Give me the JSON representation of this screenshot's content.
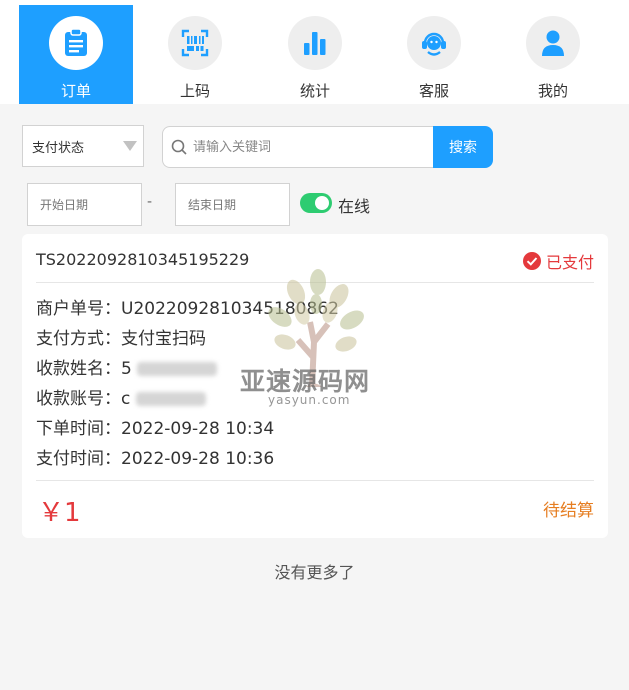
{
  "nav": {
    "items": [
      {
        "label": "订单",
        "icon": "order-icon",
        "active": true
      },
      {
        "label": "上码",
        "icon": "qrcode-icon",
        "active": false
      },
      {
        "label": "统计",
        "icon": "bar-chart-icon",
        "active": false
      },
      {
        "label": "客服",
        "icon": "customer-service-icon",
        "active": false
      },
      {
        "label": "我的",
        "icon": "user-icon",
        "active": false
      }
    ]
  },
  "filters": {
    "status_select": "支付状态",
    "search_placeholder": "请输入关键词",
    "search_button": "搜索",
    "start_date_placeholder": "开始日期",
    "end_date_placeholder": "结束日期",
    "date_separator": "-",
    "online_label": "在线",
    "online": true
  },
  "order": {
    "order_no": "TS2022092810345195229",
    "status": "已支付",
    "merchant_label": "商户单号：",
    "merchant_no": "U2022092810345180862",
    "pay_method_label": "支付方式：",
    "pay_method": "支付宝扫码",
    "payee_name_label": "收款姓名：",
    "payee_name_visible": "5",
    "payee_account_label": "收款账号：",
    "payee_account_visible": "c",
    "order_time_label": "下单时间：",
    "order_time": "2022-09-28 10:34",
    "pay_time_label": "支付时间：",
    "pay_time": "2022-09-28 10:36",
    "amount": "￥1",
    "settle_status": "待结算"
  },
  "footer": {
    "no_more": "没有更多了"
  },
  "watermark": {
    "title": "亚速源码网",
    "url": "yasyun.com"
  },
  "colors": {
    "accent": "#1e9fff",
    "paid": "#e4393c",
    "pending": "#e67e22",
    "toggle_on": "#2ecc71"
  }
}
